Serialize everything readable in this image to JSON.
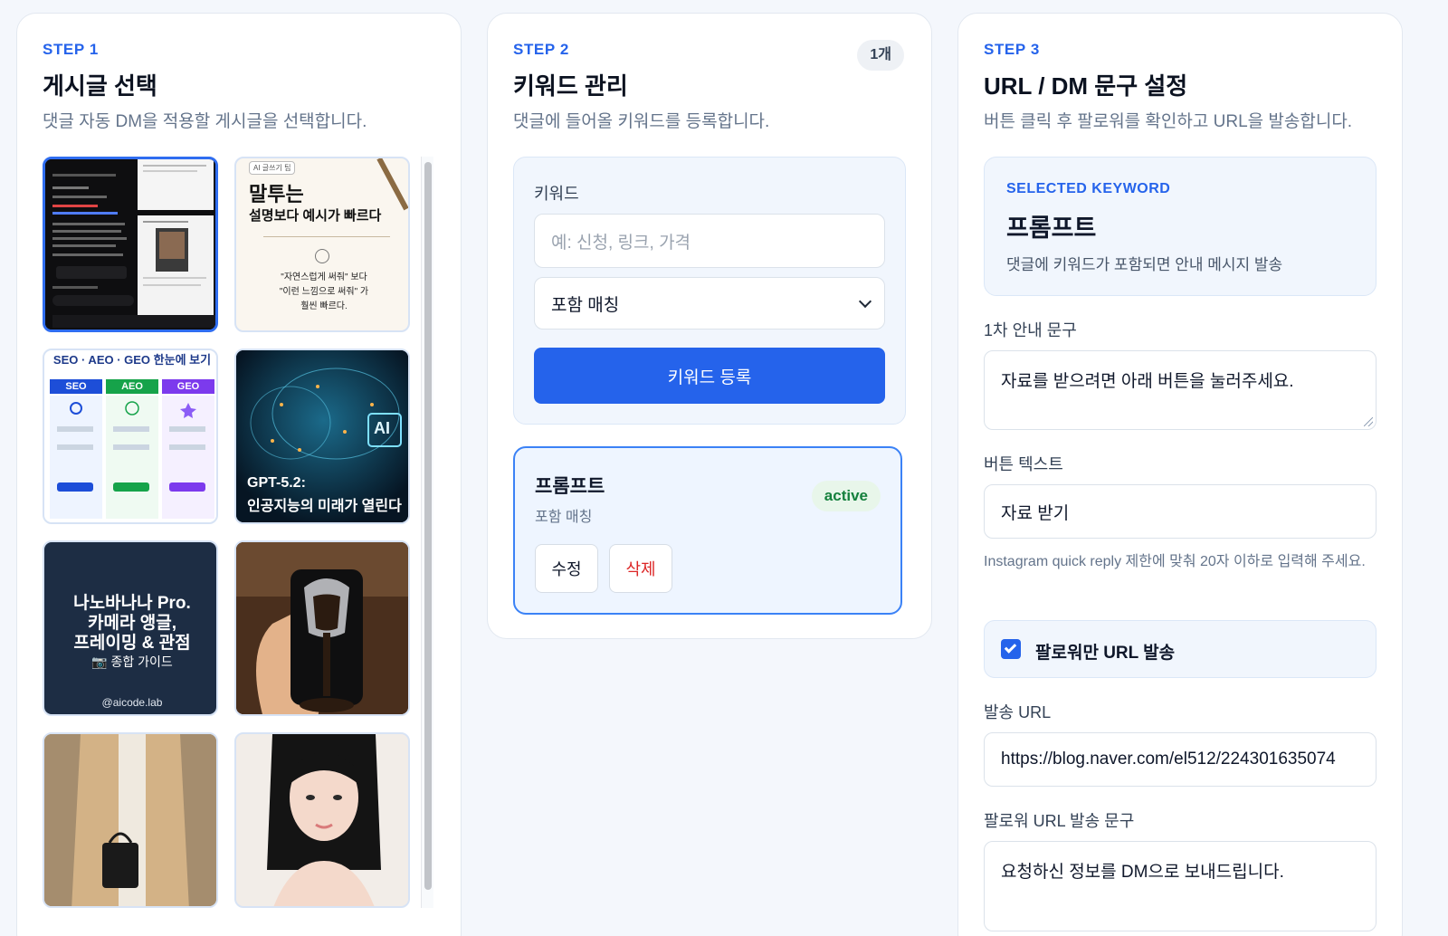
{
  "step1": {
    "step": "STEP 1",
    "title": "게시글 선택",
    "desc": "댓글 자동 DM을 적용할 게시글을 선택합니다.",
    "posts": [
      {
        "name": "post-thumb-gpt-chat",
        "selected": true
      },
      {
        "name": "post-thumb-speech-tip",
        "lines": [
          "AI 글쓰기 팁",
          "말투는",
          "설명보다 예시가 빠르다",
          "\"자연스럽게 써줘\" 보다",
          "\"이런 느낌으로 써줘\" 가",
          "훨씬 빠르다."
        ]
      },
      {
        "name": "post-thumb-seo-aeo-geo",
        "lines": [
          "SEO · AEO · GEO 한눈에 보기",
          "SEO",
          "AEO",
          "GEO"
        ]
      },
      {
        "name": "post-thumb-gpt52",
        "lines": [
          "AI",
          "GPT-5.2:",
          "인공지능의 미래가 열린다"
        ]
      },
      {
        "name": "post-thumb-nanobanana",
        "lines": [
          "나노바나나 Pro.",
          "카메라 앵글,",
          "프레이밍 & 관점",
          "종합 가이드",
          "@aicode.lab"
        ]
      },
      {
        "name": "post-thumb-coffee-phone"
      },
      {
        "name": "post-thumb-fashion-coat"
      },
      {
        "name": "post-thumb-portrait"
      }
    ]
  },
  "step2": {
    "step": "STEP 2",
    "title": "키워드 관리",
    "desc": "댓글에 들어올 키워드를 등록합니다.",
    "count": "1개",
    "keyword_label": "키워드",
    "keyword_placeholder": "예: 신청, 링크, 가격",
    "match_select": "포함 매칭",
    "register_button": "키워드 등록",
    "keywords": [
      {
        "name": "프롬프트",
        "mode": "포함 매칭",
        "status": "active",
        "edit": "수정",
        "delete": "삭제"
      }
    ]
  },
  "step3": {
    "step": "STEP 3",
    "title": "URL / DM 문구 설정",
    "desc": "버튼 클릭 후 팔로워를 확인하고 URL을 발송합니다.",
    "selected_tag": "SELECTED KEYWORD",
    "selected_keyword": "프롬프트",
    "selected_desc": "댓글에 키워드가 포함되면 안내 메시지 발송",
    "first_msg_label": "1차 안내 문구",
    "first_msg_value": "자료를 받으려면 아래 버튼을 눌러주세요.",
    "button_text_label": "버튼 텍스트",
    "button_text_value": "자료 받기",
    "hint": "Instagram quick reply 제한에 맞춰 20자 이하로 입력해 주세요.",
    "followers_only_label": "팔로워만 URL 발송",
    "followers_only": true,
    "send_url_label": "발송 URL",
    "send_url_value": "https://blog.naver.com/el512/224301635074",
    "follower_msg_label": "팔로워 URL 발송 문구",
    "follower_msg_value": "요청하신 정보를 DM으로 보내드립니다."
  },
  "colors": {
    "accent": "#2563eb",
    "active": "#15803d",
    "danger": "#dc2626"
  }
}
